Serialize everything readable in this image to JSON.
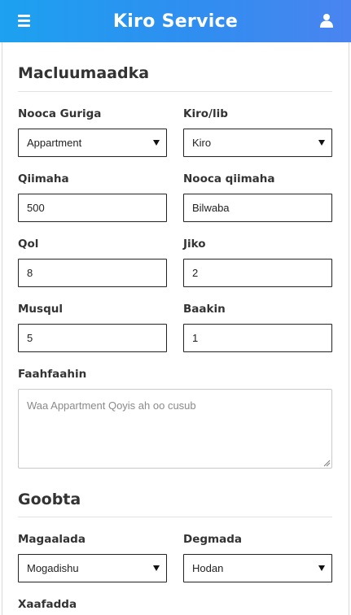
{
  "header": {
    "title": "Kiro Service",
    "menu_icon": "hamburger-menu-icon",
    "user_icon": "user-icon",
    "gradient_start": "#1da1f0",
    "gradient_end": "#4a84f0"
  },
  "info_section": {
    "title": "Macluumaadka",
    "fields": {
      "house_type": {
        "label": "Nooca Guriga",
        "value": "Appartment"
      },
      "rent_or_sale": {
        "label": "Kiro/lib",
        "value": "Kiro"
      },
      "price": {
        "label": "Qiimaha",
        "value": "500"
      },
      "price_type": {
        "label": "Nooca qiimaha",
        "value": "Bilwaba"
      },
      "rooms": {
        "label": "Qol",
        "value": "8"
      },
      "kitchen": {
        "label": "Jiko",
        "value": "2"
      },
      "bathroom": {
        "label": "Musqul",
        "value": "5"
      },
      "balcony": {
        "label": "Baakin",
        "value": "1"
      },
      "description": {
        "label": "Faahfaahin",
        "placeholder": "Waa Appartment Qoyis ah oo cusub"
      }
    }
  },
  "location_section": {
    "title": "Goobta",
    "fields": {
      "city": {
        "label": "Magaalada",
        "value": "Mogadishu"
      },
      "district": {
        "label": "Degmada",
        "value": "Hodan"
      },
      "neighborhood": {
        "label": "Xaafadda"
      }
    }
  }
}
